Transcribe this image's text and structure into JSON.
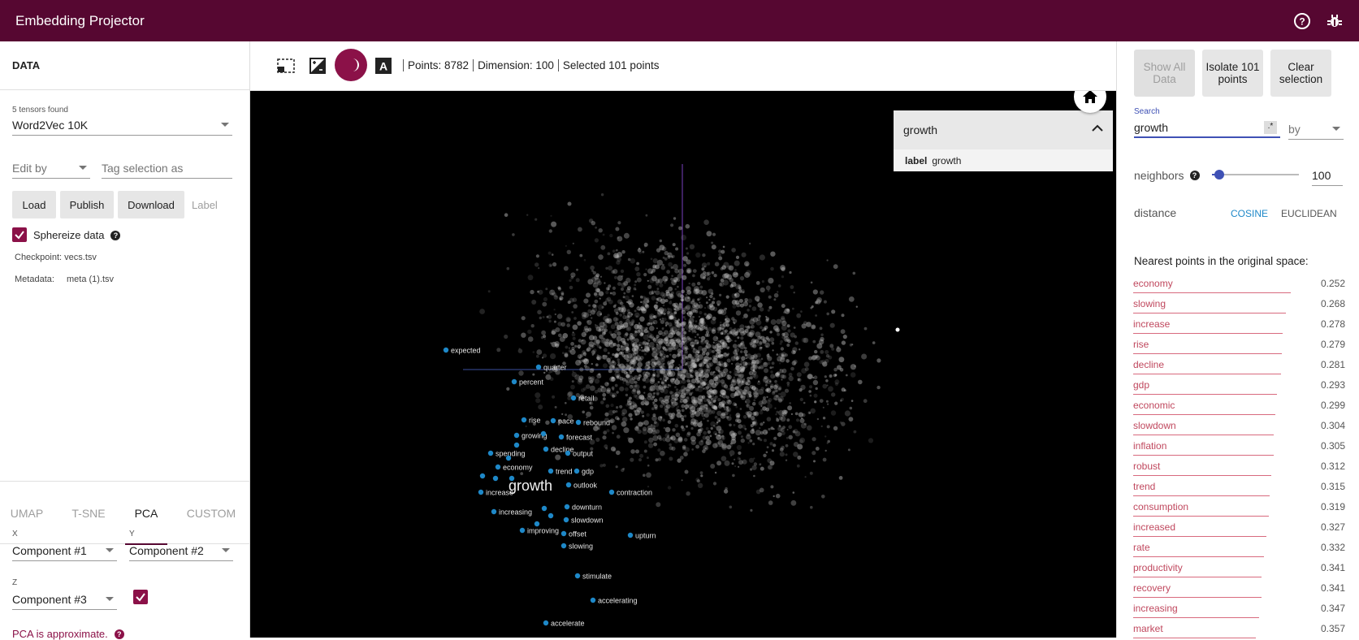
{
  "app": {
    "title": "Embedding Projector"
  },
  "left": {
    "header": "DATA",
    "tensors_found": "5 tensors found",
    "tensor_selected": "Word2Vec 10K",
    "edit_by_placeholder": "Edit by",
    "tag_selection_placeholder": "Tag selection as",
    "buttons": {
      "load": "Load",
      "publish": "Publish",
      "download": "Download",
      "label": "Label"
    },
    "sphereize_label": "Sphereize data",
    "checkpoint_label": "Checkpoint:",
    "checkpoint_value": "vecs.tsv",
    "metadata_label": "Metadata:",
    "metadata_value": "meta (1).tsv",
    "tabs": [
      "UMAP",
      "T-SNE",
      "PCA",
      "CUSTOM"
    ],
    "active_tab": "PCA",
    "pca": {
      "x_label": "X",
      "x_value": "Component #1",
      "y_label": "Y",
      "y_value": "Component #2",
      "z_label": "Z",
      "z_value": "Component #3",
      "approx_note": "PCA is approximate."
    }
  },
  "toolbar": {
    "points": "Points: 8782",
    "dimension": "Dimension: 100",
    "selected": "Selected 101 points"
  },
  "inspector": {
    "query": "growth",
    "meta_key": "label",
    "meta_value": "growth"
  },
  "viz": {
    "focus_label": "growth",
    "labels": [
      "expected",
      "quarter",
      "percent",
      "retail",
      "rise",
      "pace",
      "rebound",
      "growing",
      "forecast",
      "decline",
      "spending",
      "output",
      "economy",
      "trend",
      "gdp",
      "outlook",
      "increase",
      "contraction",
      "increasing",
      "downturn",
      "slowdown",
      "improving",
      "offset",
      "upturn",
      "slowing",
      "stimulate",
      "accelerating",
      "accelerate"
    ]
  },
  "right": {
    "buttons": {
      "show_all": "Show All Data",
      "isolate": "Isolate 101 points",
      "clear": "Clear selection"
    },
    "search_label": "Search",
    "search_value": "growth",
    "regex_glyph": ".*",
    "by_placeholder": "by",
    "neighbors_label": "neighbors",
    "neighbors_value": "100",
    "neighbors_fraction": 0.08,
    "distance_label": "distance",
    "distance_options": [
      "COSINE",
      "EUCLIDEAN"
    ],
    "distance_active": "COSINE",
    "nearest_title": "Nearest points in the original space:",
    "nearest": [
      {
        "word": "economy",
        "value": "0.252"
      },
      {
        "word": "slowing",
        "value": "0.268"
      },
      {
        "word": "increase",
        "value": "0.278"
      },
      {
        "word": "rise",
        "value": "0.279"
      },
      {
        "word": "decline",
        "value": "0.281"
      },
      {
        "word": "gdp",
        "value": "0.293"
      },
      {
        "word": "economic",
        "value": "0.299"
      },
      {
        "word": "slowdown",
        "value": "0.304"
      },
      {
        "word": "inflation",
        "value": "0.305"
      },
      {
        "word": "robust",
        "value": "0.312"
      },
      {
        "word": "trend",
        "value": "0.315"
      },
      {
        "word": "consumption",
        "value": "0.319"
      },
      {
        "word": "increased",
        "value": "0.327"
      },
      {
        "word": "rate",
        "value": "0.332"
      },
      {
        "word": "productivity",
        "value": "0.341"
      },
      {
        "word": "recovery",
        "value": "0.341"
      },
      {
        "word": "increasing",
        "value": "0.347"
      },
      {
        "word": "market",
        "value": "0.357"
      }
    ]
  },
  "colors": {
    "brand": "#560731",
    "accent": "#8b1148",
    "highlight": "#1e88c8",
    "link": "#c0485e"
  }
}
